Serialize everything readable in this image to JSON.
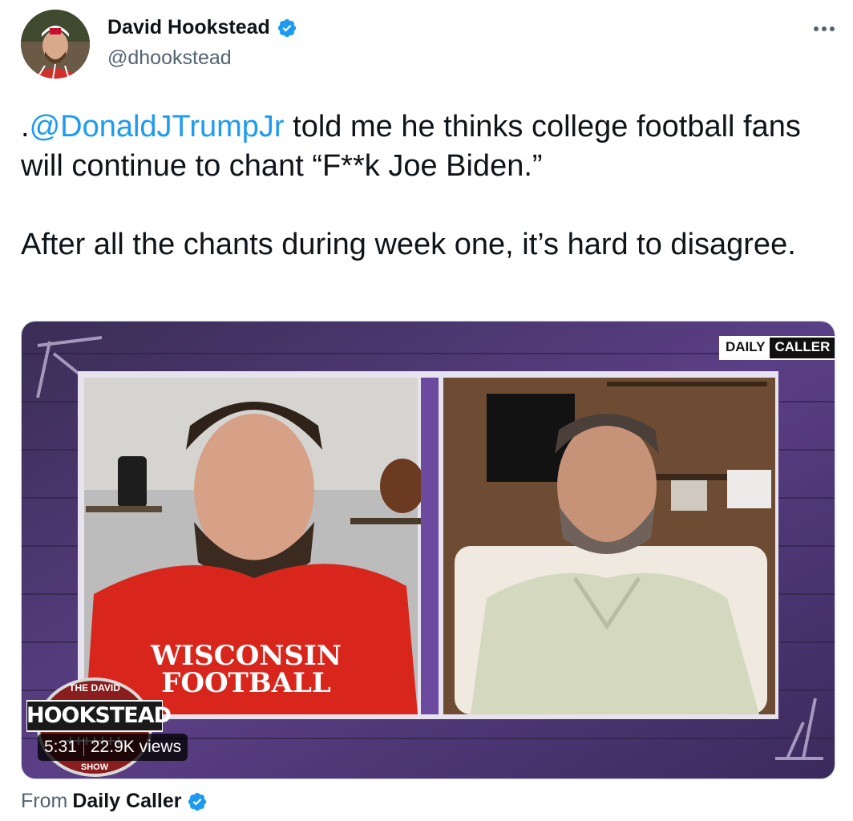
{
  "author": {
    "name": "David Hookstead",
    "handle": "@dhookstead",
    "verified": true,
    "avatar": "avatar-photo"
  },
  "menu": {
    "icon": "more-horizontal-icon"
  },
  "tweet": {
    "prefix": ".",
    "mention": "@DonaldJTrumpJr",
    "line1_rest": " told me he thinks college football fans will continue to chant “F**k Joe Biden.”",
    "paragraph2": "After all the chants during week one, it’s hard to disagree."
  },
  "video": {
    "watermark_left": "DAILY",
    "watermark_right": "CALLER",
    "show_logo": {
      "top": "THE DAVID",
      "main": "HOOKSTEAD",
      "bottom": "SHOW"
    },
    "shirt_text": "WISCONSIN FOOTBALL",
    "duration": "5:31",
    "views": "22.9K views"
  },
  "source": {
    "label": "From",
    "name": "Daily Caller",
    "verified": true
  },
  "colors": {
    "link": "#1d9bf0",
    "verified": "#1d9bf0",
    "secondary_text": "#536471"
  }
}
